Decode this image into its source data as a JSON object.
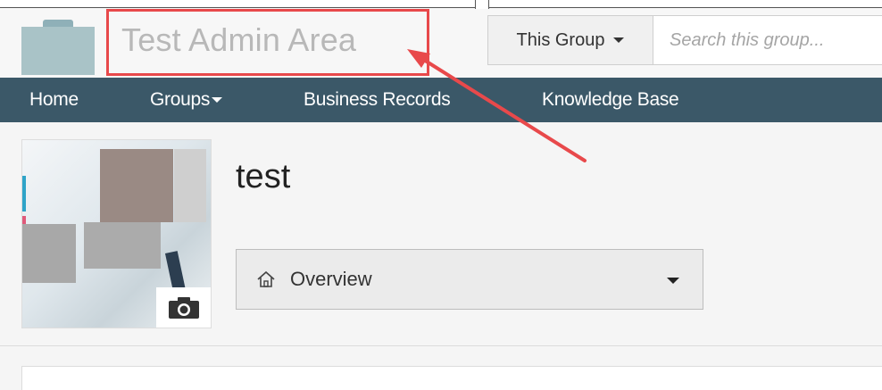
{
  "header": {
    "site_title": "Test Admin Area",
    "scope_label": "This Group",
    "search_placeholder": "Search this group..."
  },
  "nav": {
    "items": [
      {
        "label": "Home"
      },
      {
        "label": "Groups"
      },
      {
        "label": "Business Records"
      },
      {
        "label": "Knowledge Base"
      }
    ]
  },
  "group": {
    "name": "test",
    "section_label": "Overview"
  },
  "icons": {
    "camera": "camera-icon",
    "home": "home-icon",
    "caret": "chevron-down-icon"
  },
  "colors": {
    "nav_bg": "#3b5868",
    "annotation": "#e8494b",
    "logo": "#a9c3c7"
  }
}
